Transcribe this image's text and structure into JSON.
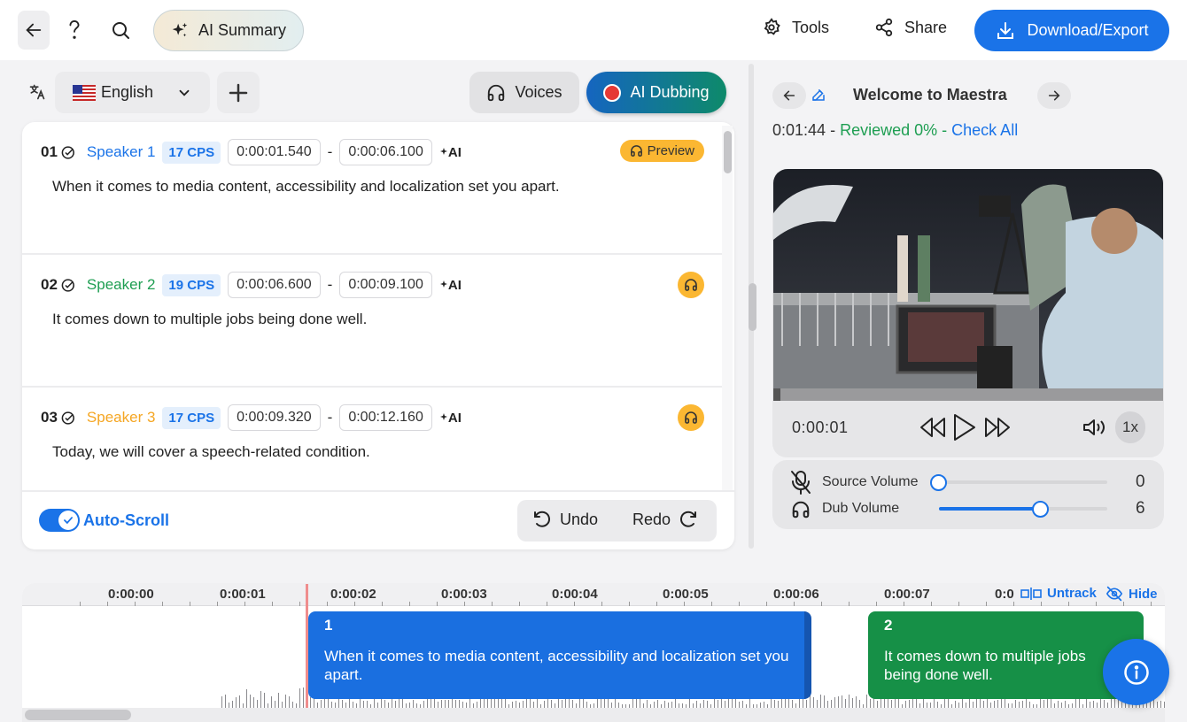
{
  "topbar": {
    "back_icon": "arrow-left-icon",
    "help_icon": "question-icon",
    "search_icon": "search-icon",
    "ai_summary_label": "AI Summary",
    "tools_label": "Tools",
    "share_label": "Share",
    "download_label": "Download/Export"
  },
  "language": {
    "selected": "English",
    "flag": "us-flag-icon"
  },
  "actions": {
    "voices_label": "Voices",
    "dubbing_label": "AI Dubbing"
  },
  "segments": [
    {
      "num": "01",
      "speaker": "Speaker 1",
      "speaker_color": "#1a73e8",
      "cps": "17 CPS",
      "start": "0:00:01.540",
      "end": "0:00:06.100",
      "ai": "AI",
      "text": "When it comes to media content, accessibility and localization set you apart.",
      "preview_label": "Preview"
    },
    {
      "num": "02",
      "speaker": "Speaker 2",
      "speaker_color": "#1e9e52",
      "cps": "19 CPS",
      "start": "0:00:06.600",
      "end": "0:00:09.100",
      "ai": "AI",
      "text": "It comes down to multiple jobs being done well."
    },
    {
      "num": "03",
      "speaker": "Speaker 3",
      "speaker_color": "#f5a623",
      "cps": "17 CPS",
      "start": "0:00:09.320",
      "end": "0:00:12.160",
      "ai": "AI",
      "text": "Today, we will cover a speech-related condition."
    }
  ],
  "footer": {
    "autoscroll_label": "Auto-Scroll",
    "autoscroll_on": true,
    "undo_label": "Undo",
    "redo_label": "Redo"
  },
  "media": {
    "title": "Welcome to Maestra",
    "duration": "0:01:44",
    "reviewed": "Reviewed 0%",
    "check_all": "Check All",
    "current_time": "0:00:01",
    "speed": "1x",
    "progress_fraction": 0.01
  },
  "mixer": {
    "source_label": "Source Volume",
    "source_value": "0",
    "dub_label": "Dub Volume",
    "dub_value": "6"
  },
  "timeline": {
    "ticks": [
      "0:00:00",
      "0:00:01",
      "0:00:02",
      "0:00:03",
      "0:00:04",
      "0:00:05",
      "0:00:06",
      "0:00:07",
      "0:0"
    ],
    "untrack_label": "Untrack",
    "hide_label": "Hide",
    "clips": [
      {
        "num": "1",
        "text": "When it comes to media content, accessibility and localization set you apart."
      },
      {
        "num": "2",
        "text": "It comes down to multiple jobs being done well."
      }
    ]
  },
  "colors": {
    "accent": "#1a73e8",
    "preview": "#fbb732",
    "clip1": "#1a6fe0",
    "clip2": "#169047"
  }
}
